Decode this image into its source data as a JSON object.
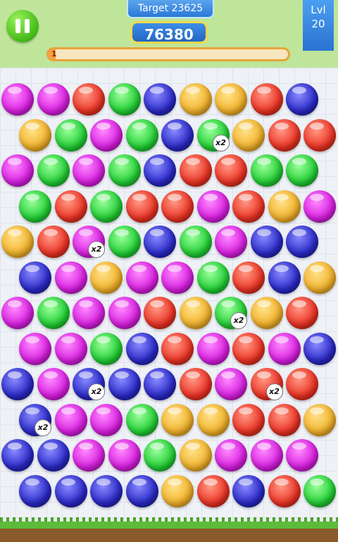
{
  "header": {
    "target_label": "Target 23625",
    "score": "76380",
    "level_label": "Lvl",
    "level_number": "20",
    "progress_number": "1",
    "progress_fraction": 0.03
  },
  "colors": {
    "magenta": "#d81fe0",
    "red": "#ec3324",
    "green": "#22cf35",
    "blue": "#2a29c8",
    "orange": "#f2b22a",
    "header_bg": "#bfe59a"
  },
  "board": {
    "multiplier_label": "x2",
    "rows": [
      [
        "magenta",
        "magenta",
        "red",
        "green",
        "blue",
        "orange",
        "orange",
        "red",
        "blue"
      ],
      [
        "orange",
        "green",
        "magenta",
        "green",
        "blue",
        "green",
        "orange",
        "red",
        "red"
      ],
      [
        "magenta",
        "green",
        "magenta",
        "green",
        "blue",
        "red",
        "red",
        "green",
        "green"
      ],
      [
        "green",
        "red",
        "green",
        "red",
        "red",
        "magenta",
        "red",
        "orange",
        "magenta"
      ],
      [
        "orange",
        "red",
        "magenta",
        "green",
        "blue",
        "green",
        "magenta",
        "blue",
        "blue"
      ],
      [
        "blue",
        "magenta",
        "orange",
        "magenta",
        "magenta",
        "green",
        "red",
        "blue",
        "orange"
      ],
      [
        "magenta",
        "green",
        "magenta",
        "magenta",
        "red",
        "orange",
        "green",
        "orange",
        "red"
      ],
      [
        "magenta",
        "magenta",
        "green",
        "blue",
        "red",
        "magenta",
        "red",
        "magenta",
        "blue"
      ],
      [
        "blue",
        "magenta",
        "blue",
        "blue",
        "blue",
        "red",
        "magenta",
        "red",
        "red"
      ],
      [
        "blue",
        "magenta",
        "magenta",
        "green",
        "orange",
        "orange",
        "red",
        "red",
        "orange"
      ],
      [
        "blue",
        "blue",
        "magenta",
        "magenta",
        "green",
        "orange",
        "magenta",
        "magenta",
        "magenta"
      ],
      [
        "blue",
        "blue",
        "blue",
        "blue",
        "orange",
        "red",
        "blue",
        "red",
        "green"
      ]
    ],
    "multipliers": [
      [
        1,
        5
      ],
      [
        4,
        2
      ],
      [
        6,
        6
      ],
      [
        8,
        2
      ],
      [
        8,
        7
      ],
      [
        9,
        0
      ]
    ]
  }
}
